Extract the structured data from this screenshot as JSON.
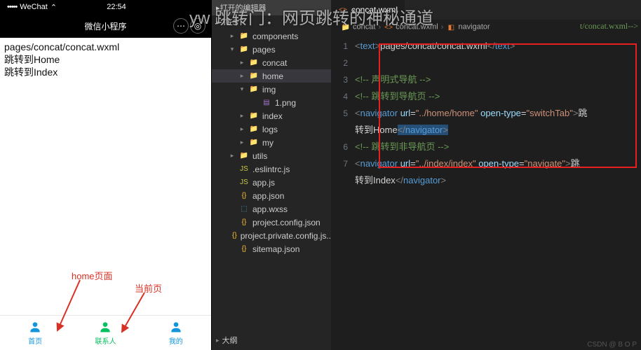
{
  "overlay_title": "yw 跳转门：网页跳转的神秘通道",
  "phone": {
    "status": {
      "carrier_dots": "•••••",
      "carrier": "WeChat",
      "signal": "⌃",
      "time": "22:54"
    },
    "wx_title": "微信小程序",
    "page_lines": [
      "pages/concat/concat.wxml",
      "跳转到Home",
      "跳转到Index"
    ],
    "anno_home": "home页面",
    "anno_current": "当前页",
    "tabs": [
      {
        "label": "首页",
        "active": false
      },
      {
        "label": "联系人",
        "active": true
      },
      {
        "label": "我的",
        "active": false
      }
    ]
  },
  "tree": {
    "toolbar_text": "打开的编辑器",
    "section": "TEST",
    "foot_text": "大纲",
    "items": [
      {
        "indent": 24,
        "chev": "▸",
        "icon": "folder",
        "klass": "folder",
        "label": "components"
      },
      {
        "indent": 24,
        "chev": "▾",
        "icon": "folder",
        "klass": "folder-red",
        "label": "pages"
      },
      {
        "indent": 38,
        "chev": "▸",
        "icon": "folder",
        "klass": "folder",
        "label": "concat"
      },
      {
        "indent": 38,
        "chev": "▸",
        "icon": "folder",
        "klass": "folder",
        "label": "home",
        "selected": true
      },
      {
        "indent": 38,
        "chev": "▾",
        "icon": "folder",
        "klass": "folder-green",
        "label": "img"
      },
      {
        "indent": 56,
        "chev": "",
        "icon": "img",
        "klass": "png",
        "label": "1.png"
      },
      {
        "indent": 38,
        "chev": "▸",
        "icon": "folder",
        "klass": "folder",
        "label": "index"
      },
      {
        "indent": 38,
        "chev": "▸",
        "icon": "folder",
        "klass": "folder",
        "label": "logs"
      },
      {
        "indent": 38,
        "chev": "▸",
        "icon": "folder",
        "klass": "folder",
        "label": "my"
      },
      {
        "indent": 24,
        "chev": "▸",
        "icon": "folder",
        "klass": "folder",
        "label": "utils"
      },
      {
        "indent": 24,
        "chev": "",
        "icon": "js",
        "klass": "js",
        "label": ".eslintrc.js"
      },
      {
        "indent": 24,
        "chev": "",
        "icon": "js",
        "klass": "js",
        "label": "app.js"
      },
      {
        "indent": 24,
        "chev": "",
        "icon": "json",
        "klass": "json",
        "label": "app.json"
      },
      {
        "indent": 24,
        "chev": "",
        "icon": "wxss",
        "klass": "wxss",
        "label": "app.wxss"
      },
      {
        "indent": 24,
        "chev": "",
        "icon": "json",
        "klass": "json",
        "label": "project.config.json"
      },
      {
        "indent": 24,
        "chev": "",
        "icon": "json",
        "klass": "json",
        "label": "project.private.config.js..."
      },
      {
        "indent": 24,
        "chev": "",
        "icon": "json",
        "klass": "json",
        "label": "sitemap.json"
      }
    ]
  },
  "editor": {
    "tabs": [
      {
        "label": "concat.wxml",
        "icon": "wxml",
        "active": true
      }
    ],
    "crumbs": [
      {
        "text": "concat",
        "icon": "folder"
      },
      {
        "text": "concat.wxml",
        "icon": "wxml"
      },
      {
        "text": "navigator",
        "icon": "tag"
      }
    ],
    "lines": [
      {
        "n": "1",
        "html": "<span class='c-pun'>&lt;</span><span class='c-tag'>text</span><span class='c-pun'>&gt;</span>pages/concat/concat.wxml<span class='c-pun'>&lt;/</span><span class='c-tag'>text</span><span class='c-pun'>&gt;</span>"
      },
      {
        "n": "2",
        "html": ""
      },
      {
        "n": "3",
        "html": "<span class='c-cmt'>&lt;!-- 声明式导航 --&gt;</span>"
      },
      {
        "n": "4",
        "html": "<span class='c-cmt'>&lt;!-- 跳转到导航页 --&gt;</span>"
      },
      {
        "n": "5",
        "html": "<span class='c-pun'>&lt;</span><span class='c-tag'>navigator</span> <span class='c-attr'>url</span>=<span class='c-str'>\"../home/home\"</span> <span class='c-attr'>open-type</span>=<span class='c-str'>\"switchTab\"</span><span class='c-pun'>&gt;</span>跳"
      },
      {
        "n": "",
        "html": "转到Home<span class='code-sel'><span class='c-pun'>&lt;/</span><span class='c-tag'>navigator</span><span class='c-pun'>&gt;</span></span>"
      },
      {
        "n": "6",
        "html": "<span class='c-cmt'>&lt;!-- 跳转到非导航页 --&gt;</span>"
      },
      {
        "n": "7",
        "html": "<span class='c-pun'>&lt;</span><span class='c-tag'>navigator</span> <span class='c-attr'>url</span>=<span class='c-str'>\"../index/index\"</span> <span class='c-attr'>open-type</span>=<span class='c-str'>\"navigate\"</span><span class='c-pun'>&gt;</span>跳"
      },
      {
        "n": "",
        "html": "转到Index<span class='c-pun'>&lt;/</span><span class='c-tag'>navigator</span><span class='c-pun'>&gt;</span>"
      }
    ],
    "path_hint": "t/concat.wxml-->"
  },
  "footer_watermark": "CSDN @ B O P"
}
